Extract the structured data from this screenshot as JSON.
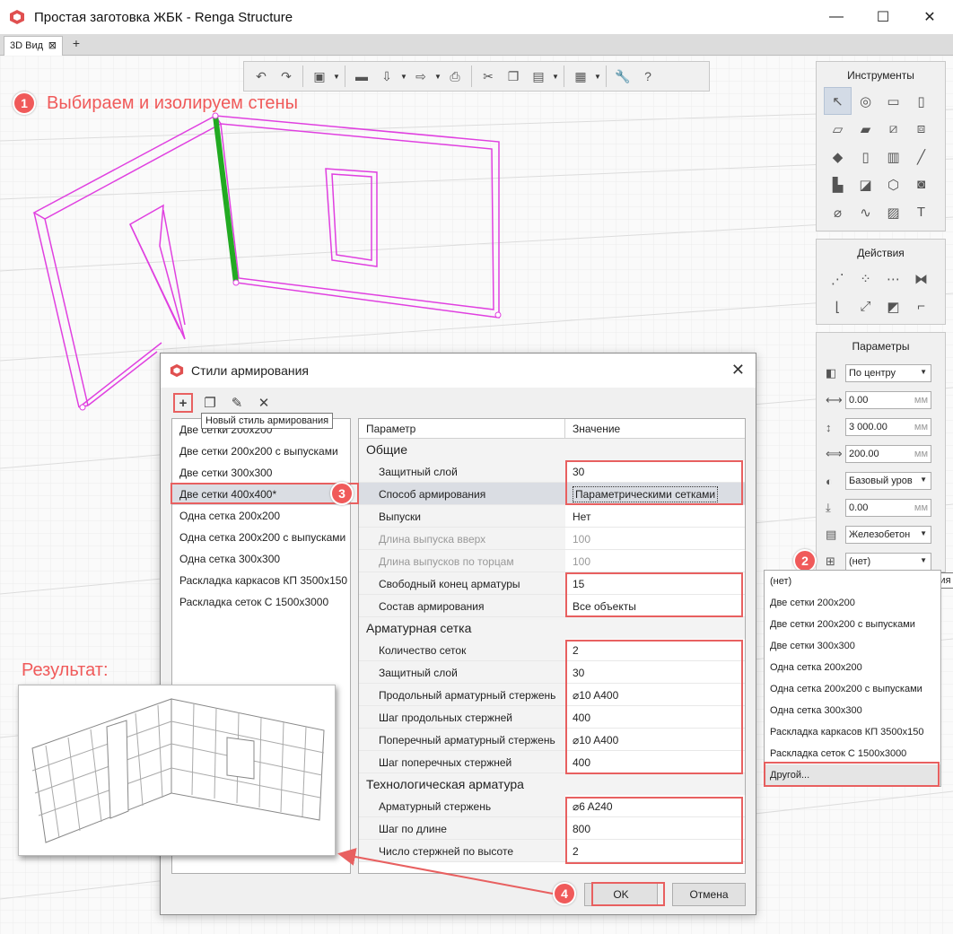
{
  "window": {
    "title": "Простая заготовка ЖБК - Renga Structure",
    "minimize": "—",
    "maximize": "☐",
    "close": "✕"
  },
  "tabs": [
    {
      "label": "3D Вид",
      "close": "⊠"
    }
  ],
  "tab_add": "+",
  "annotations": {
    "step1_badge": "1",
    "step1_text": "Выбираем и изолируем стены",
    "step2_badge": "2",
    "step3_badge": "3",
    "step4_badge": "4",
    "result_label": "Результат:"
  },
  "panels": {
    "tools_title": "Инструменты",
    "actions_title": "Действия",
    "params_title": "Параметры"
  },
  "parameters": {
    "placement": "По центру",
    "offset": "0.00",
    "offset_unit": "мм",
    "height": "3 000.00",
    "height_unit": "мм",
    "thickness": "200.00",
    "thickness_unit": "мм",
    "level": "Базовый уров",
    "level_offset": "0.00",
    "level_offset_unit": "мм",
    "material": "Железобетон",
    "reinforcement_style": "(нет)"
  },
  "tooltip_style": "Стиль армирования",
  "dropdown_items": [
    "(нет)",
    "Две сетки 200x200",
    "Две сетки 200x200 с выпусками",
    "Две сетки 300x300",
    "Одна сетка 200x200",
    "Одна сетка 200x200 с выпусками",
    "Одна сетка 300x300",
    "Раскладка каркасов КП 3500x150",
    "Раскладка сеток С 1500x3000",
    "Другой..."
  ],
  "dialog": {
    "title": "Стили армирования",
    "close": "✕",
    "tooltip_new": "Новый стиль армирования",
    "styles": [
      "Две сетки 200x200",
      "Две сетки 200x200 с выпусками",
      "Две сетки 300x300",
      "Две сетки 400x400*",
      "Одна сетка 200x200",
      "Одна сетка 200x200 с выпусками",
      "Одна сетка 300x300",
      "Раскладка каркасов КП 3500x150",
      "Раскладка сеток С 1500x3000"
    ],
    "col_param": "Параметр",
    "col_value": "Значение",
    "group_general": "Общие",
    "group_mesh": "Арматурная сетка",
    "group_tech": "Технологическая арматура",
    "rows_general": [
      {
        "name": "Защитный слой",
        "value": "30"
      },
      {
        "name": "Способ армирования",
        "value": "Параметрическими сетками"
      },
      {
        "name": "Выпуски",
        "value": "Нет"
      },
      {
        "name": "Длина выпуска вверх",
        "value": "100"
      },
      {
        "name": "Длина выпусков по торцам",
        "value": "100"
      },
      {
        "name": "Свободный конец арматуры",
        "value": "15"
      },
      {
        "name": "Состав армирования",
        "value": "Все объекты"
      }
    ],
    "rows_mesh": [
      {
        "name": "Количество сеток",
        "value": "2"
      },
      {
        "name": "Защитный слой",
        "value": "30"
      },
      {
        "name": "Продольный арматурный стержень",
        "value": "⌀10 A400"
      },
      {
        "name": "Шаг продольных стержней",
        "value": "400"
      },
      {
        "name": "Поперечный арматурный стержень",
        "value": "⌀10 A400"
      },
      {
        "name": "Шаг поперечных стержней",
        "value": "400"
      }
    ],
    "rows_tech": [
      {
        "name": "Арматурный стержень",
        "value": "⌀6 A240"
      },
      {
        "name": "Шаг по длине",
        "value": "800"
      },
      {
        "name": "Число стержней по высоте",
        "value": "2"
      }
    ],
    "ok": "OK",
    "cancel": "Отмена"
  }
}
